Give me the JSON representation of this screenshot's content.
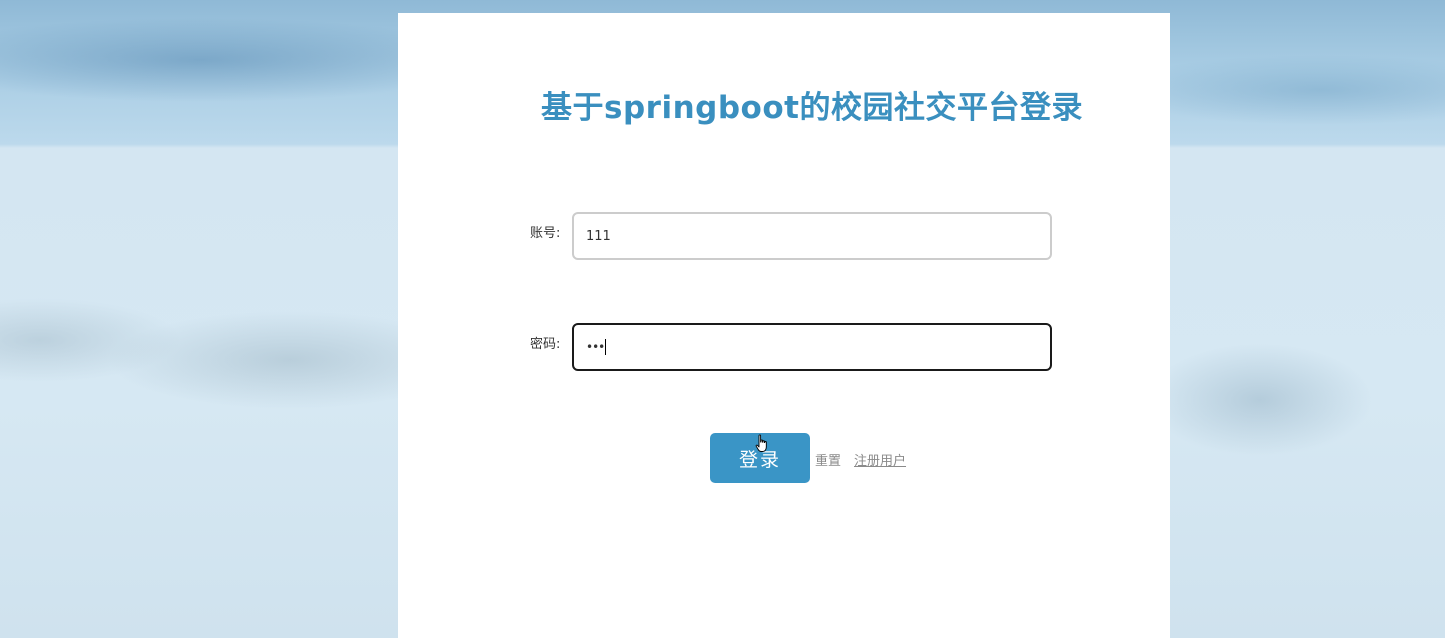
{
  "login": {
    "title": "基于springboot的校园社交平台登录",
    "username_label": "账号:",
    "username_value": "111",
    "password_label": "密码:",
    "password_value": "•••",
    "login_button": "登录",
    "reset_button": "重置",
    "register_link": "注册用户"
  },
  "colors": {
    "accent": "#3a95c6",
    "title": "#3a8fbf",
    "muted_text": "#8a8a8a"
  },
  "icons": {
    "cursor": "hand-pointer-icon"
  }
}
